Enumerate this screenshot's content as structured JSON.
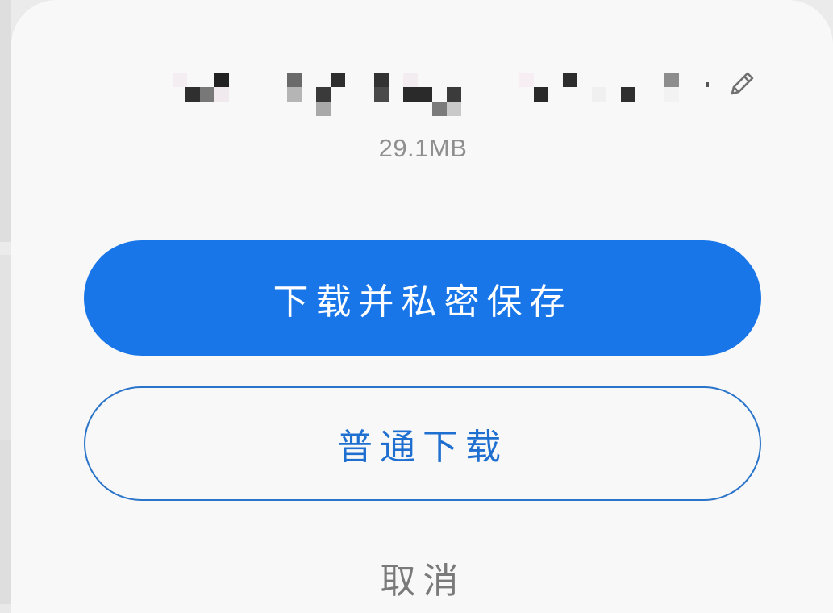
{
  "dialog": {
    "file_size": "29.1MB",
    "primary_button_label": "下载并私密保存",
    "secondary_button_label": "普通下载",
    "cancel_label": "取消",
    "edit_icon": "pencil-icon",
    "filename_state": "pixelated"
  },
  "colors": {
    "primary": "#1976e8",
    "secondary_border": "#2a74c9",
    "secondary_text": "#1e6fd0",
    "muted_text": "#8f8f8f",
    "sheet_bg": "#f8f8f8"
  }
}
